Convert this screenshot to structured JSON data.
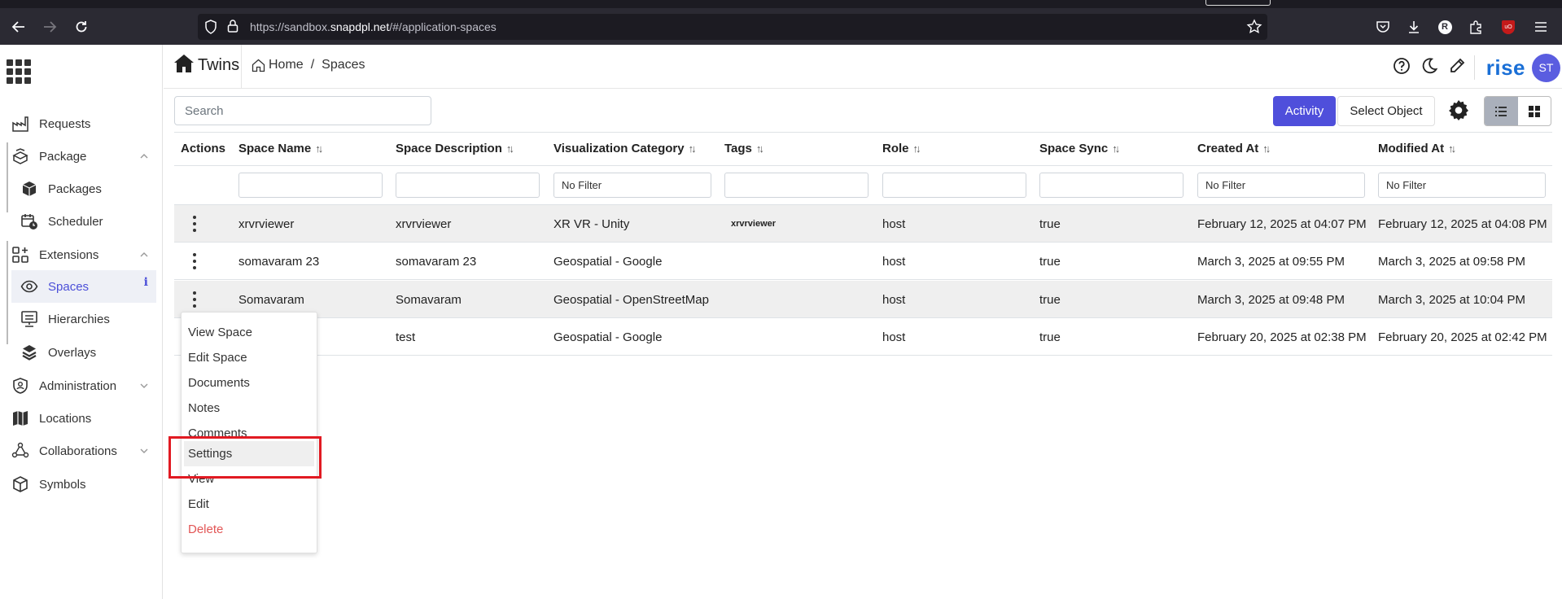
{
  "browser": {
    "url_prefix": "https://sandbox.",
    "url_domain": "snapdpl.net",
    "url_suffix": "/#/application-spaces",
    "profile_letter": "R",
    "ext_label": "uO"
  },
  "header": {
    "app_name": "Twins",
    "breadcrumb_home": "Home",
    "breadcrumb_sep": "/",
    "breadcrumb_current": "Spaces",
    "logo": "rise",
    "avatar_initials": "ST"
  },
  "sidebar": {
    "items": [
      {
        "label": "Requests"
      },
      {
        "label": "Package"
      },
      {
        "label": "Packages"
      },
      {
        "label": "Scheduler"
      },
      {
        "label": "Extensions"
      },
      {
        "label": "Spaces"
      },
      {
        "label": "Hierarchies"
      },
      {
        "label": "Overlays"
      },
      {
        "label": "Administration"
      },
      {
        "label": "Locations"
      },
      {
        "label": "Collaborations"
      },
      {
        "label": "Symbols"
      }
    ],
    "info_badge": "i"
  },
  "toolbar": {
    "search_placeholder": "Search",
    "activity_label": "Activity",
    "select_object_label": "Select Object"
  },
  "table": {
    "headers": {
      "actions": "Actions",
      "space_name": "Space Name",
      "space_description": "Space Description",
      "visualization_category": "Visualization Category",
      "tags": "Tags",
      "role": "Role",
      "space_sync": "Space Sync",
      "created_at": "Created At",
      "modified_at": "Modified At"
    },
    "sort_glyph": "↑↓",
    "filters": {
      "visualization_category": "No Filter",
      "created_at": "No Filter",
      "modified_at": "No Filter"
    },
    "rows": [
      {
        "name": "xrvrviewer",
        "description": "xrvrviewer",
        "category": "XR VR - Unity",
        "tags": "xrvrviewer",
        "role": "host",
        "sync": "true",
        "created": "February 12, 2025 at 04:07 PM",
        "modified": "February 12, 2025 at 04:08 PM"
      },
      {
        "name": "somavaram 23",
        "description": "somavaram 23",
        "category": "Geospatial - Google",
        "tags": "",
        "role": "host",
        "sync": "true",
        "created": "March 3, 2025 at 09:55 PM",
        "modified": "March 3, 2025 at 09:58 PM"
      },
      {
        "name": "Somavaram",
        "description": "Somavaram",
        "category": "Geospatial - OpenStreetMap",
        "tags": "",
        "role": "host",
        "sync": "true",
        "created": "March 3, 2025 at 09:48 PM",
        "modified": "March 3, 2025 at 10:04 PM"
      },
      {
        "name": "",
        "description": "test",
        "category": "Geospatial - Google",
        "tags": "",
        "role": "host",
        "sync": "true",
        "created": "February 20, 2025 at 02:38 PM",
        "modified": "February 20, 2025 at 02:42 PM"
      }
    ]
  },
  "context_menu": {
    "items": [
      "View Space",
      "Edit Space",
      "Documents",
      "Notes",
      "Comments",
      "Settings",
      "View",
      "Edit",
      "Delete"
    ]
  },
  "colors": {
    "accent": "#4f4fdb",
    "logo": "#1a6fd6",
    "danger": "#e25656",
    "highlight_box": "#e11a22"
  }
}
